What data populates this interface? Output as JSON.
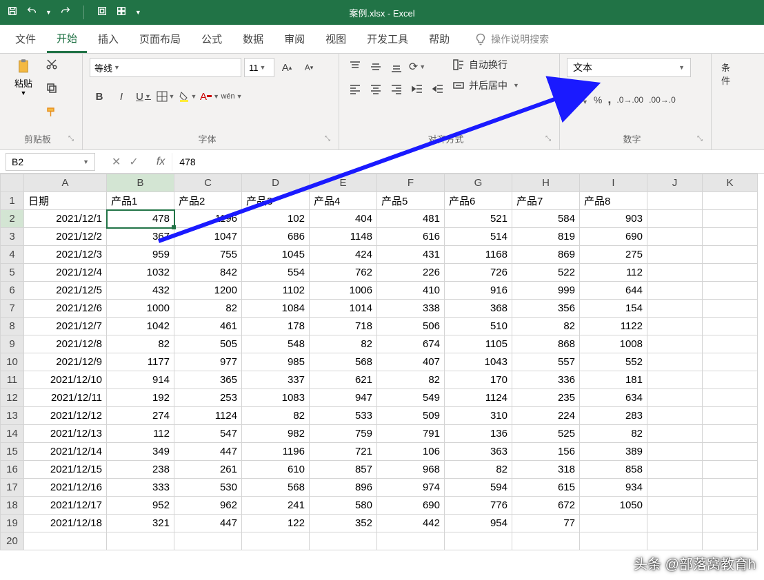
{
  "app": {
    "title": "案例.xlsx - Excel"
  },
  "qat": {
    "save": "保存",
    "undo": "撤销",
    "redo": "重做"
  },
  "tabs": {
    "file": "文件",
    "home": "开始",
    "insert": "插入",
    "layout": "页面布局",
    "formulas": "公式",
    "data": "数据",
    "review": "审阅",
    "view": "视图",
    "dev": "开发工具",
    "help": "帮助",
    "tellme": "操作说明搜索"
  },
  "ribbon": {
    "clipboard": {
      "paste": "粘贴",
      "group": "剪贴板"
    },
    "font": {
      "name": "等线",
      "size": "11",
      "group": "字体"
    },
    "align": {
      "wrap": "自动换行",
      "merge": "并后居中",
      "group": "对齐方式"
    },
    "number": {
      "format": "文本",
      "group": "数字"
    },
    "cond": {
      "label": "条件"
    }
  },
  "namebox": {
    "ref": "B2",
    "formula": "478"
  },
  "columns": [
    "A",
    "B",
    "C",
    "D",
    "E",
    "F",
    "G",
    "H",
    "I",
    "J",
    "K"
  ],
  "headers": {
    "date": "日期",
    "p1": "产品1",
    "p2": "产品2",
    "p3": "产品3",
    "p4": "产品4",
    "p5": "产品5",
    "p6": "产品6",
    "p7": "产品7",
    "p8": "产品8"
  },
  "rows": [
    {
      "n": 2,
      "d": "2021/12/1",
      "v": [
        478,
        1196,
        102,
        404,
        481,
        521,
        584,
        903
      ]
    },
    {
      "n": 3,
      "d": "2021/12/2",
      "v": [
        367,
        1047,
        686,
        1148,
        616,
        514,
        819,
        690
      ]
    },
    {
      "n": 4,
      "d": "2021/12/3",
      "v": [
        959,
        755,
        1045,
        424,
        431,
        1168,
        869,
        275
      ]
    },
    {
      "n": 5,
      "d": "2021/12/4",
      "v": [
        1032,
        842,
        554,
        762,
        226,
        726,
        522,
        112
      ]
    },
    {
      "n": 6,
      "d": "2021/12/5",
      "v": [
        432,
        1200,
        1102,
        1006,
        410,
        916,
        999,
        644
      ]
    },
    {
      "n": 7,
      "d": "2021/12/6",
      "v": [
        1000,
        82,
        1084,
        1014,
        338,
        368,
        356,
        154
      ]
    },
    {
      "n": 8,
      "d": "2021/12/7",
      "v": [
        1042,
        461,
        178,
        718,
        506,
        510,
        82,
        1122
      ]
    },
    {
      "n": 9,
      "d": "2021/12/8",
      "v": [
        82,
        505,
        548,
        82,
        674,
        1105,
        868,
        1008
      ]
    },
    {
      "n": 10,
      "d": "2021/12/9",
      "v": [
        1177,
        977,
        985,
        568,
        407,
        1043,
        557,
        552
      ]
    },
    {
      "n": 11,
      "d": "2021/12/10",
      "v": [
        914,
        365,
        337,
        621,
        82,
        170,
        336,
        181
      ]
    },
    {
      "n": 12,
      "d": "2021/12/11",
      "v": [
        192,
        253,
        1083,
        947,
        549,
        1124,
        235,
        634
      ]
    },
    {
      "n": 13,
      "d": "2021/12/12",
      "v": [
        274,
        1124,
        82,
        533,
        509,
        310,
        224,
        283
      ]
    },
    {
      "n": 14,
      "d": "2021/12/13",
      "v": [
        112,
        547,
        982,
        759,
        791,
        136,
        525,
        82
      ]
    },
    {
      "n": 15,
      "d": "2021/12/14",
      "v": [
        349,
        447,
        1196,
        721,
        106,
        363,
        156,
        389
      ]
    },
    {
      "n": 16,
      "d": "2021/12/15",
      "v": [
        238,
        261,
        610,
        857,
        968,
        82,
        318,
        858
      ]
    },
    {
      "n": 17,
      "d": "2021/12/16",
      "v": [
        333,
        530,
        568,
        896,
        974,
        594,
        615,
        934
      ]
    },
    {
      "n": 18,
      "d": "2021/12/17",
      "v": [
        952,
        962,
        241,
        580,
        690,
        776,
        672,
        1050
      ]
    },
    {
      "n": 19,
      "d": "2021/12/18",
      "v": [
        321,
        447,
        122,
        352,
        442,
        954,
        "77",
        ""
      ]
    }
  ],
  "watermark": "头条 @部落窝教育h"
}
